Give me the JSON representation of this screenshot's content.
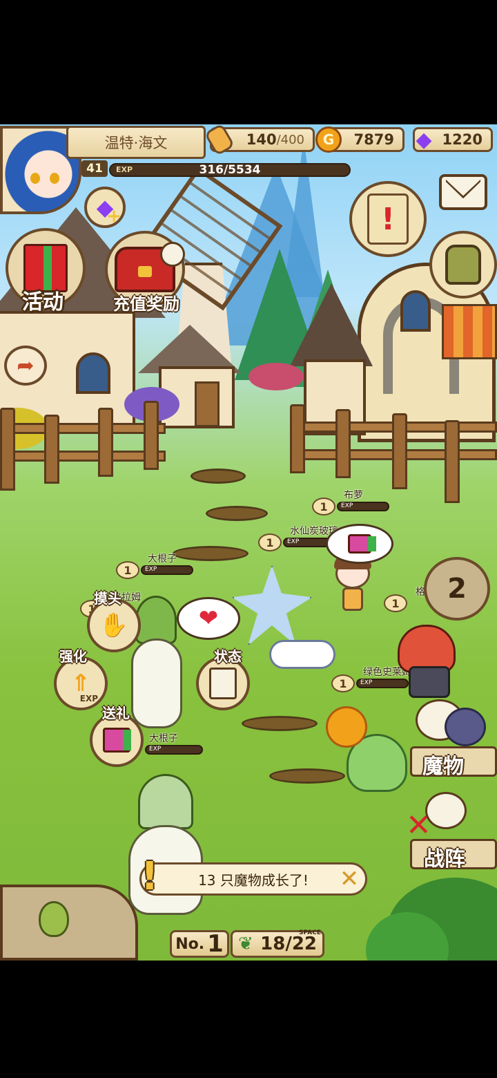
{
  "player": {
    "name": "温特·海文",
    "level": "41",
    "exp_label": "EXP",
    "exp": "316/5534"
  },
  "resources": {
    "bread": {
      "current": "140",
      "max": "/400"
    },
    "gold": {
      "value": "7879",
      "icon_letter": "G"
    },
    "gems": {
      "value": "1220"
    }
  },
  "left_menu": {
    "events_label": "活动",
    "recharge_label": "充值奖励"
  },
  "monsters": [
    {
      "name": "布萝",
      "level": "1"
    },
    {
      "name": "水仙炭玻璃",
      "level": "1"
    },
    {
      "name": "大根子",
      "level": "1"
    },
    {
      "name": "格拉姆",
      "level": "1"
    },
    {
      "name": "格",
      "level": "1"
    },
    {
      "name": "绿色史莱姆",
      "level": "1"
    },
    {
      "name": "大根子",
      "level": "1"
    }
  ],
  "level_tag": "LEVEL",
  "exp_tag": "EXP",
  "actions": {
    "pet": "摸头",
    "strengthen": "强化",
    "status": "状态",
    "gift": "送礼",
    "exp_badge": "EXP"
  },
  "page_button": "2",
  "right_menu": {
    "monsters": "魔物",
    "formation": "战阵"
  },
  "notification": "13 只魔物成长了!",
  "bottom": {
    "farm_label": "No.",
    "farm_number": "1",
    "space_label": "SPACE",
    "space": "18/22"
  },
  "colors": {
    "frame_brown": "#6b4a2a",
    "parchment": "#f7e9c7",
    "grass": "#88c23e",
    "sky": "#8fd2f5",
    "gem_purple": "#8b3ff0",
    "gold": "#f2a21a"
  },
  "icons": [
    "bread-icon",
    "gold-coin-icon",
    "gem-icon",
    "mail-icon",
    "quest-scroll-icon",
    "backpack-icon",
    "gift-icon",
    "chest-icon",
    "clock-icon",
    "share-icon",
    "heart-icon",
    "close-icon"
  ]
}
